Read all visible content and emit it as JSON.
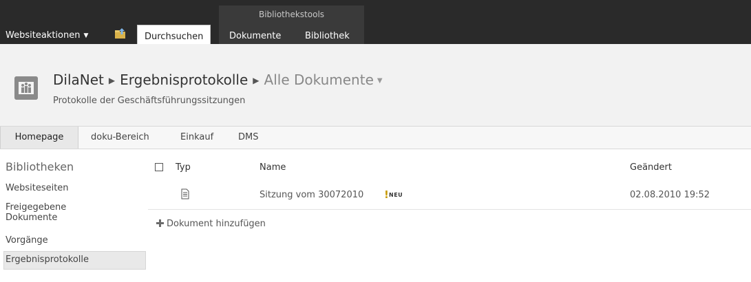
{
  "ribbon": {
    "context_group": "Bibliothekstools",
    "site_actions": "Websiteaktionen",
    "tabs": [
      {
        "label": "Durchsuchen",
        "active": true
      },
      {
        "label": "Dokumente",
        "active": false
      },
      {
        "label": "Bibliothek",
        "active": false
      }
    ]
  },
  "title_area": {
    "breadcrumb": [
      "DilaNet",
      "Ergebnisprotokolle",
      "Alle Dokumente"
    ],
    "description": "Protokolle der Geschäftsführungssitzungen"
  },
  "top_nav": [
    "Homepage",
    "doku-Bereich",
    "Einkauf",
    "DMS"
  ],
  "quick_launch": {
    "heading": "Bibliotheken",
    "items": [
      "Websiteseiten",
      "Freigegebene Dokumente",
      "Vorgänge",
      "Ergebnisprotokolle"
    ]
  },
  "list": {
    "columns": {
      "type": "Typ",
      "name": "Name",
      "modified": "Geändert"
    },
    "rows": [
      {
        "type": "document-icon",
        "name": "Sitzung vom 30072010",
        "badge": "NEU",
        "modified": "02.08.2010 19:52"
      }
    ],
    "add_link": "Dokument hinzufügen"
  },
  "colors": {
    "ribbon_bg": "#2a2a2a",
    "context_bg": "#3a3a3a",
    "title_bg": "#f2f2f2",
    "new_flag": "#c79a00"
  }
}
